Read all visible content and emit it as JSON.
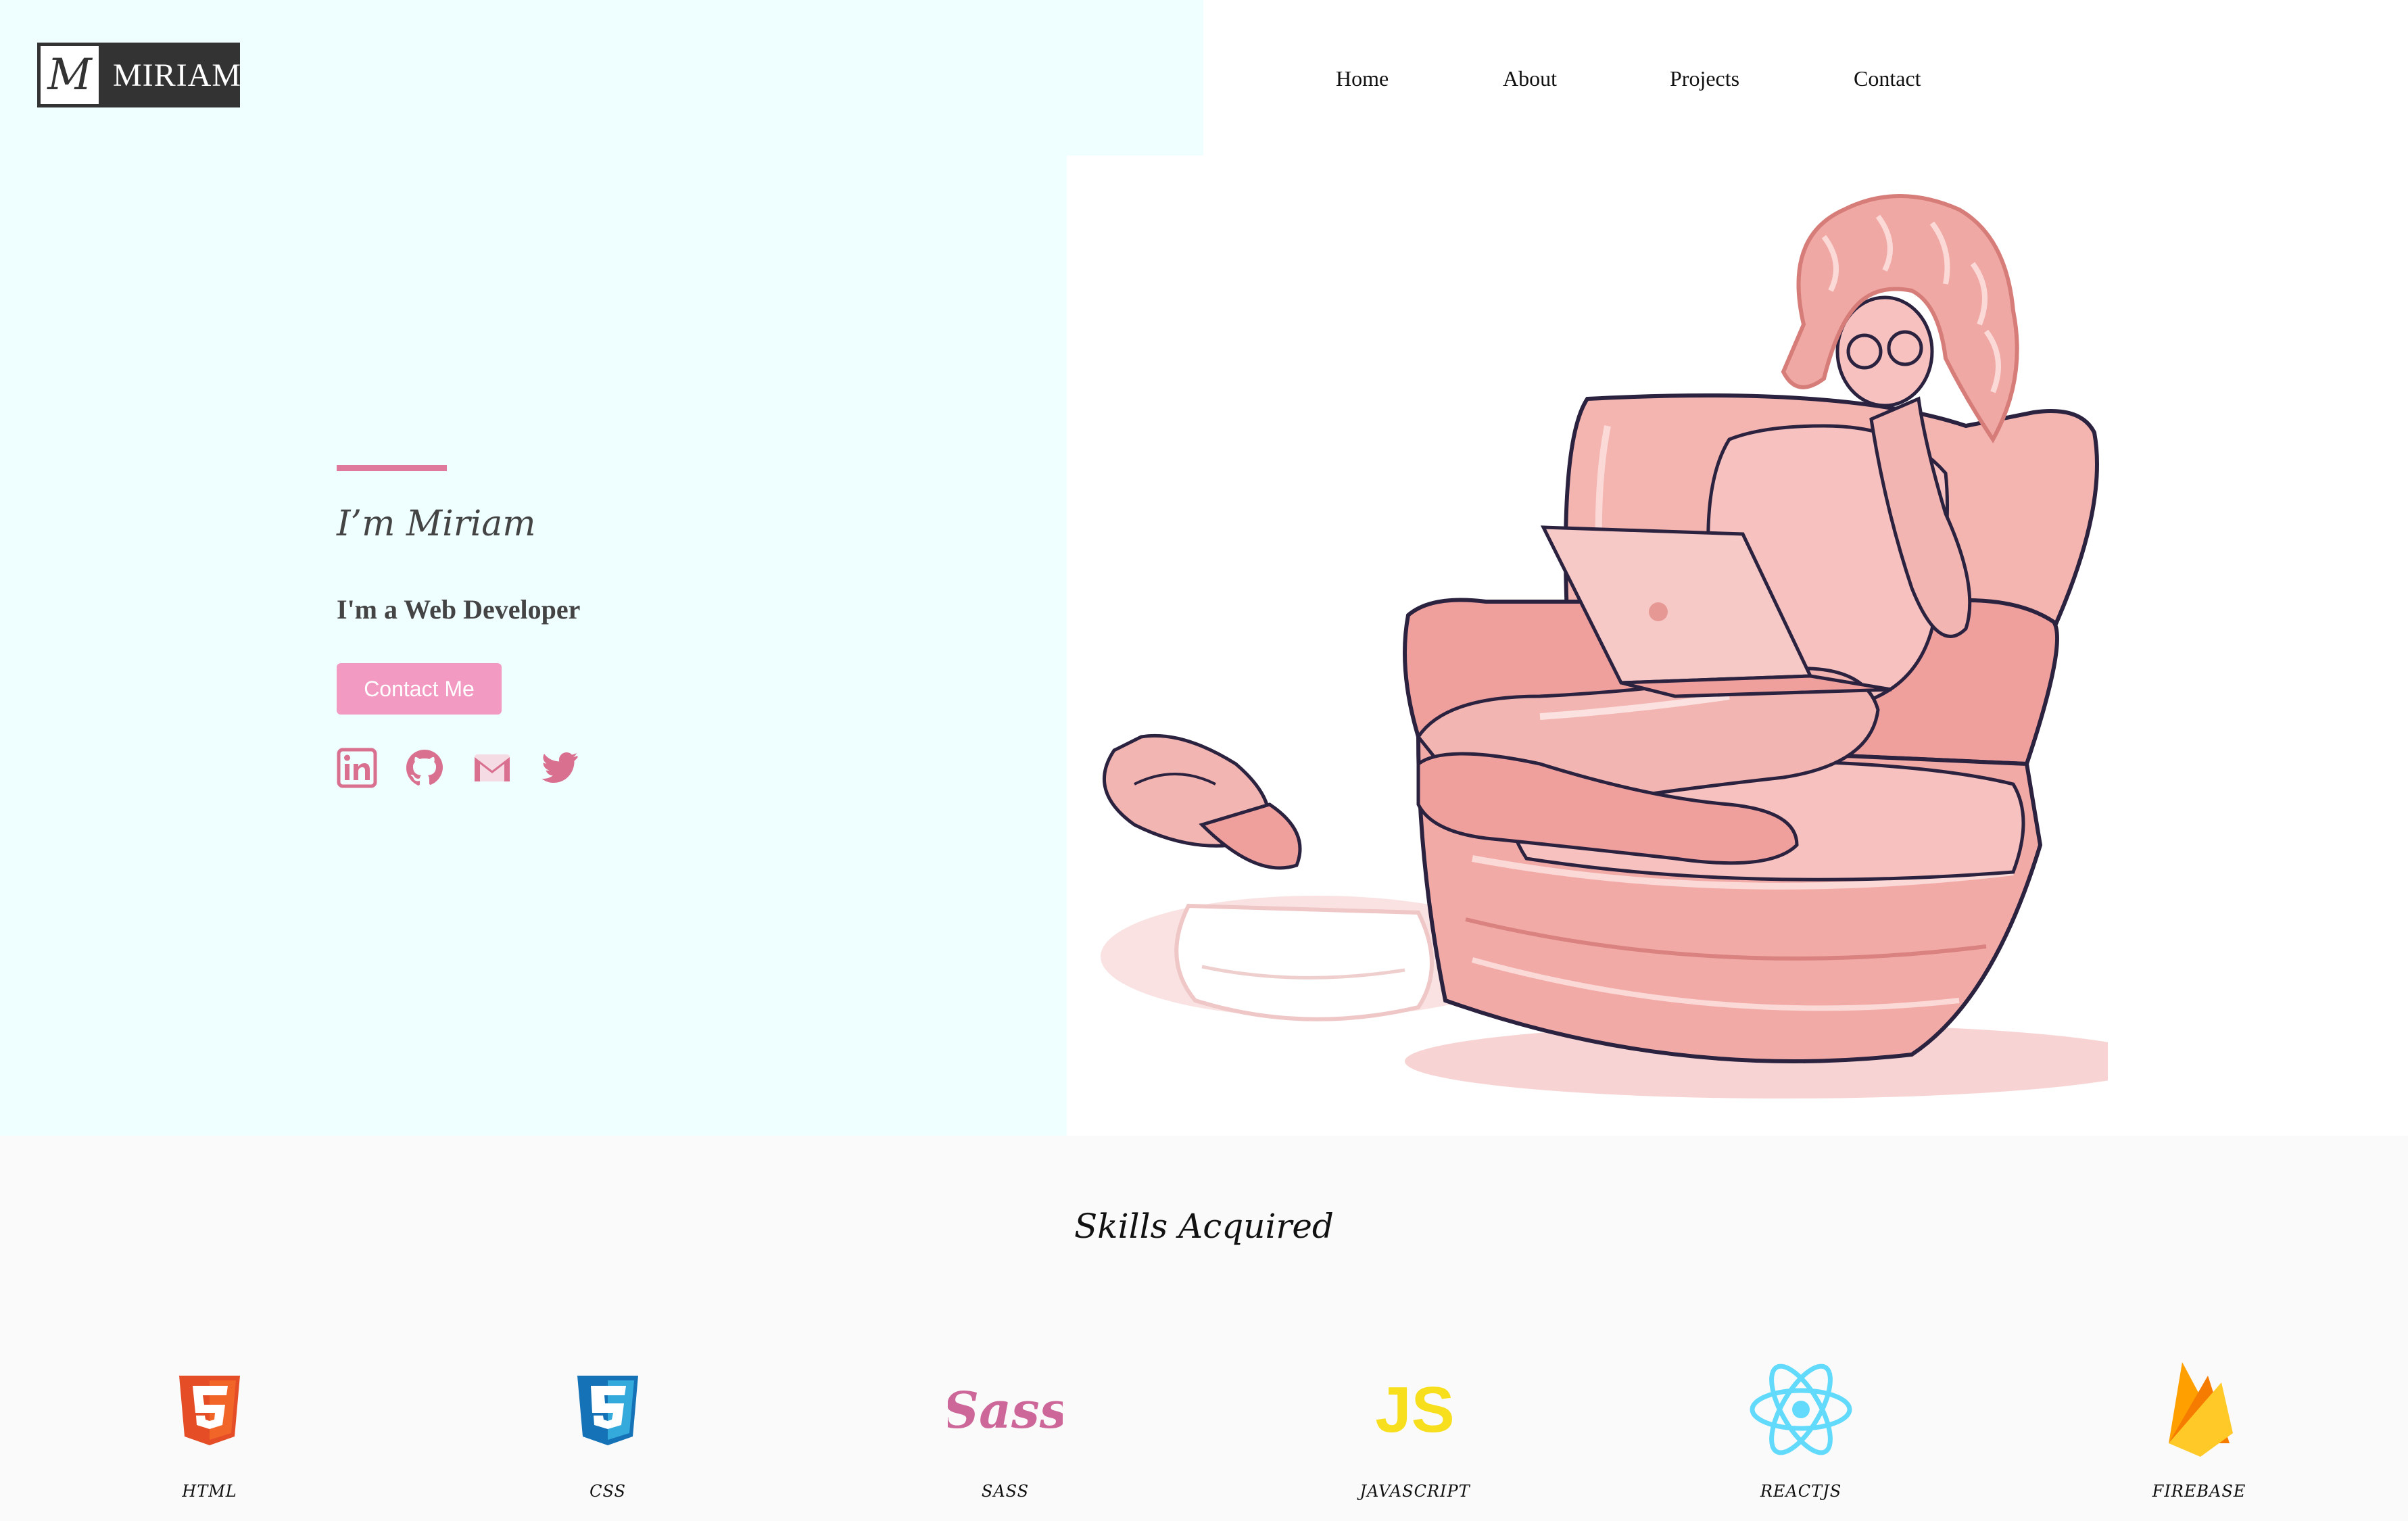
{
  "brand": {
    "logo_letter": "M",
    "name": "MIRIAM"
  },
  "nav": {
    "items": [
      "Home",
      "About",
      "Projects",
      "Contact"
    ]
  },
  "hero": {
    "title": "I’m Miriam",
    "subtitle": "I'm a Web Developer",
    "cta_label": "Contact Me",
    "socials": [
      "linkedin-icon",
      "github-icon",
      "gmail-icon",
      "twitter-icon"
    ]
  },
  "skills": {
    "title": "Skills Acquired",
    "items": [
      {
        "label": "HTML",
        "icon": "html5-icon"
      },
      {
        "label": "CSS",
        "icon": "css3-icon"
      },
      {
        "label": "SASS",
        "icon": "sass-icon"
      },
      {
        "label": "JAVASCRIPT",
        "icon": "javascript-icon",
        "logo_text": "JS"
      },
      {
        "label": "REACTJS",
        "icon": "react-icon"
      },
      {
        "label": "FIREBASE",
        "icon": "firebase-icon"
      }
    ]
  },
  "colors": {
    "hero_bg": "#effeff",
    "accent": "#e07a9c",
    "button": "#f39ac2",
    "skills_bg": "#fafafa"
  }
}
